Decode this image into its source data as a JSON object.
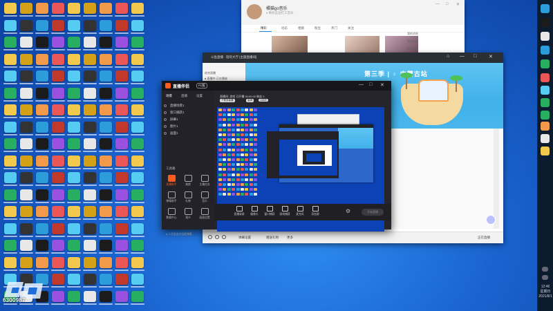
{
  "watermark": {
    "text": "6300987"
  },
  "window_social": {
    "username": "橘猫go音乐",
    "subtitle": "♦ 奇妙这边打工音乐",
    "tabs": [
      "精彩",
      "动态",
      "相册",
      "粉丝",
      "热门",
      "关注"
    ],
    "side_items": [
      "我的消息",
      "我的收藏",
      "最近足迹"
    ],
    "controls": {
      "minimize": "—",
      "maximize": "□",
      "close": "✕"
    }
  },
  "window_browser": {
    "title": "斗鱼直播 · 陪玩大厅 [主题直播间]",
    "left_items": [
      "综合直播",
      "● 直播中·正在播放"
    ],
    "banner_title": "第三季 | ♀ 内蒙古站",
    "footer": {
      "item1": "弹幕设置",
      "item2": "赠送礼物",
      "item3": "更多",
      "right": "正在直播"
    },
    "controls": {
      "minimize": "—",
      "maximize": "□",
      "close": "✕"
    }
  },
  "window_stream": {
    "brand": "直播伴侣",
    "version": "PC版",
    "tabs": [
      "场景",
      "直播",
      "设置"
    ],
    "scenes": [
      "直播场景1",
      "窗口捕获1",
      "屏幕1",
      "图片1",
      "画面1"
    ],
    "tools_title": "工具箱",
    "tools": [
      {
        "label": "直播助手",
        "hot": true
      },
      {
        "label": "美颜",
        "hot": false
      },
      {
        "label": "主播任务",
        "hot": false
      },
      {
        "label": "弹幕助手",
        "hot": false
      },
      {
        "label": "礼物",
        "hot": false
      },
      {
        "label": "音乐",
        "hot": false
      },
      {
        "label": "数据中心",
        "hot": false
      },
      {
        "label": "观众",
        "hot": false
      },
      {
        "label": "画面设置",
        "hot": false
      }
    ],
    "bottom_tip": "● 人员发送对话框弹幕",
    "info_line": "直播间: 游戏  已开播 00:00:00  粉丝 0",
    "badges": [
      "下载安装器",
      "高清",
      "1080P"
    ],
    "toolbar": [
      "直播录屏",
      "摄像头",
      "窗口捕获",
      "游戏捕获",
      "麦克风",
      "添加源"
    ],
    "start_button": "开始直播",
    "controls": {
      "minimize": "—",
      "maximize": "□",
      "close": "✕"
    }
  },
  "taskbar": {
    "time": "12:46",
    "date": "星期日",
    "date2": "2021/8/1"
  },
  "colors": {
    "accent": "#ff5b1f",
    "desktop": "#1a63cf",
    "banner": "#41b0ea"
  }
}
